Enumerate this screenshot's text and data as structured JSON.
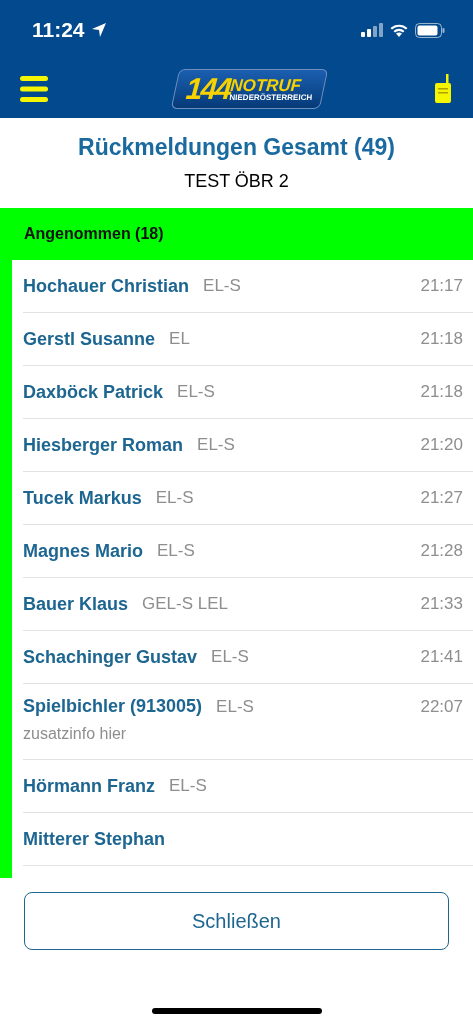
{
  "status_bar": {
    "time": "11:24"
  },
  "header": {
    "logo": {
      "number": "144",
      "word": "NOTRUF",
      "region": "NIEDERÖSTERREICH"
    }
  },
  "title": "Rückmeldungen Gesamt (49)",
  "subtitle": "TEST ÖBR 2",
  "section": {
    "label": "Angenommen (18)",
    "color": "#00ff00"
  },
  "rows": [
    {
      "name": "Hochauer Christian",
      "role": "EL-S",
      "time": "21:17"
    },
    {
      "name": "Gerstl Susanne",
      "role": "EL",
      "time": "21:18"
    },
    {
      "name": "Daxböck Patrick",
      "role": "EL-S",
      "time": "21:18"
    },
    {
      "name": "Hiesberger Roman",
      "role": "EL-S",
      "time": "21:20"
    },
    {
      "name": "Tucek Markus",
      "role": "EL-S",
      "time": "21:27"
    },
    {
      "name": "Magnes Mario",
      "role": "EL-S",
      "time": "21:28"
    },
    {
      "name": "Bauer Klaus",
      "role": "GEL-S LEL",
      "time": "21:33"
    },
    {
      "name": "Schachinger Gustav",
      "role": "EL-S",
      "time": "21:41"
    },
    {
      "name": "Spielbichler (913005)",
      "role": "EL-S",
      "time": "22:07",
      "note": "zusatzinfo hier"
    },
    {
      "name": "Hörmann Franz",
      "role": "EL-S"
    },
    {
      "name": "Mitterer Stephan"
    }
  ],
  "close_button": "Schließen"
}
